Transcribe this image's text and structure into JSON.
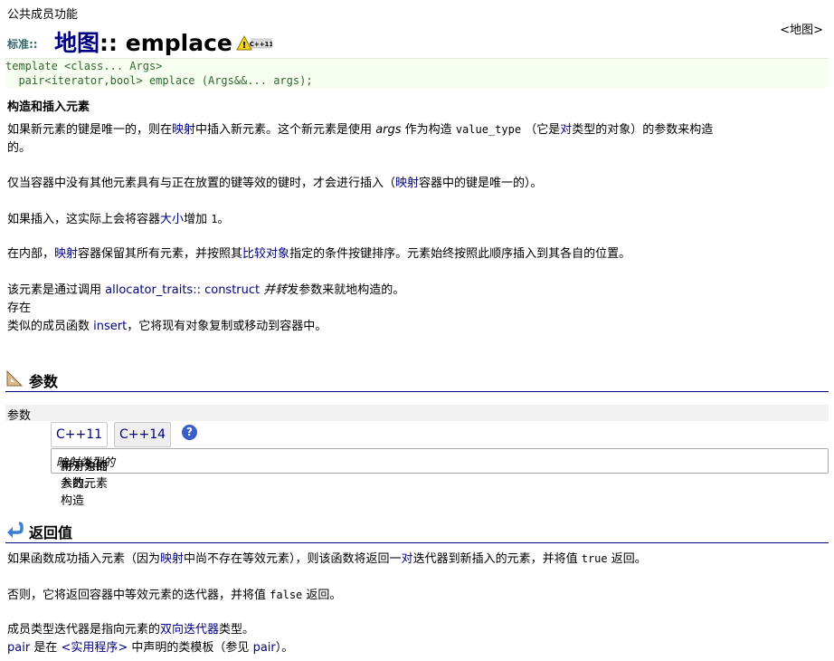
{
  "header": {
    "public_functions": "公共成员功能",
    "namespace": "标准::",
    "title_map": "地图",
    "title_sep": "::",
    "title_fn": "emplace",
    "badge": "C++11",
    "map_ref": "<地图>"
  },
  "prototype": {
    "line1": "template <class... Args>",
    "line2": "  pair<iterator,bool> emplace (Args&&... args);"
  },
  "heading": "构造和插入元素",
  "p1": {
    "a": "如果新元素的键是唯一的，则在",
    "link_map": "映射",
    "b": "中插入新元素。这个新元素是使用",
    "args": "args",
    "c": "作为构造",
    "code": "value_type",
    "d": "（它是",
    "link_pair": "对",
    "e": "类型的对象）的参数来构造",
    "f": "的。"
  },
  "p2": {
    "a": "仅当容器中没有其他元素具有与正在放置的键等效的键时，才会进行插入（",
    "link_map": "映射",
    "b": "容器中的键是唯一的）。"
  },
  "p3": {
    "a": "如果插入，这实际上会将容器",
    "link_size": "大小",
    "b": "增加",
    "num": "1",
    "c": "。"
  },
  "p4": {
    "a": "在内部，",
    "link_map": "映射",
    "b": "容器保留其所有元素，并按照其",
    "link_cmp": "比较对象",
    "c": "指定的条件按键排序。元素始终按照此顺序插入到其各自的位置。"
  },
  "p5": {
    "a": "该元素是通过调用",
    "link_alloc": "allocator_traits:: construct",
    "b": "并转",
    "c": "发参数来就地构造的。",
    "line2": "存在",
    "d": "类似的成员函数",
    "link_insert": "insert",
    "e": "，它将现有对象复制或移动到容器中。"
  },
  "params": {
    "section_title": "参数",
    "row_label": "参数",
    "tabs": [
      "C++11",
      "C++14"
    ],
    "help": "?",
    "desc_a": "用于为插入的元素构造",
    "desc_em": "映射类型的",
    "desc_b": "新对象的参数。"
  },
  "return": {
    "section_title": "返回值",
    "p1a": "如果函数成功插入元素（因为",
    "p1_link_map": "映射",
    "p1b": "中尚不存在等效元素），则该函数将返回一",
    "p1_link_pair": "对",
    "p1c": "迭代器到新插入的元素，并将值",
    "p1_true": "true",
    "p1d": "返回。",
    "p2a": "否则，它将返回容器中等效元素的迭代器，并将值",
    "p2_false": "false",
    "p2b": "返回。",
    "p3a": "成员类型迭代器是指向元素的",
    "p3_link": "双向迭代器",
    "p3b": "类型。",
    "p4_pair": "pair",
    "p4a": "是在",
    "p4_util": "<实用程序>",
    "p4b": "中声明的类模板（参见",
    "p4_pair2": "pair",
    "p4c": "）。"
  }
}
